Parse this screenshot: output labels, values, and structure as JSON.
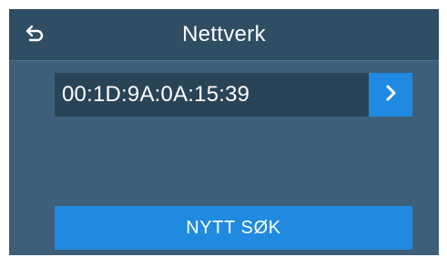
{
  "header": {
    "title": "Nettverk",
    "back_icon": "back-arrow-icon"
  },
  "network": {
    "selected_value": "00:1D:9A:0A:15:39",
    "next_icon": "chevron-right-icon"
  },
  "actions": {
    "search_label": "NYTT SØK"
  },
  "colors": {
    "background": "#3d5f7a",
    "header": "#2f4d63",
    "field": "#2a4457",
    "accent": "#1f8ae0",
    "text": "#ffffff"
  }
}
